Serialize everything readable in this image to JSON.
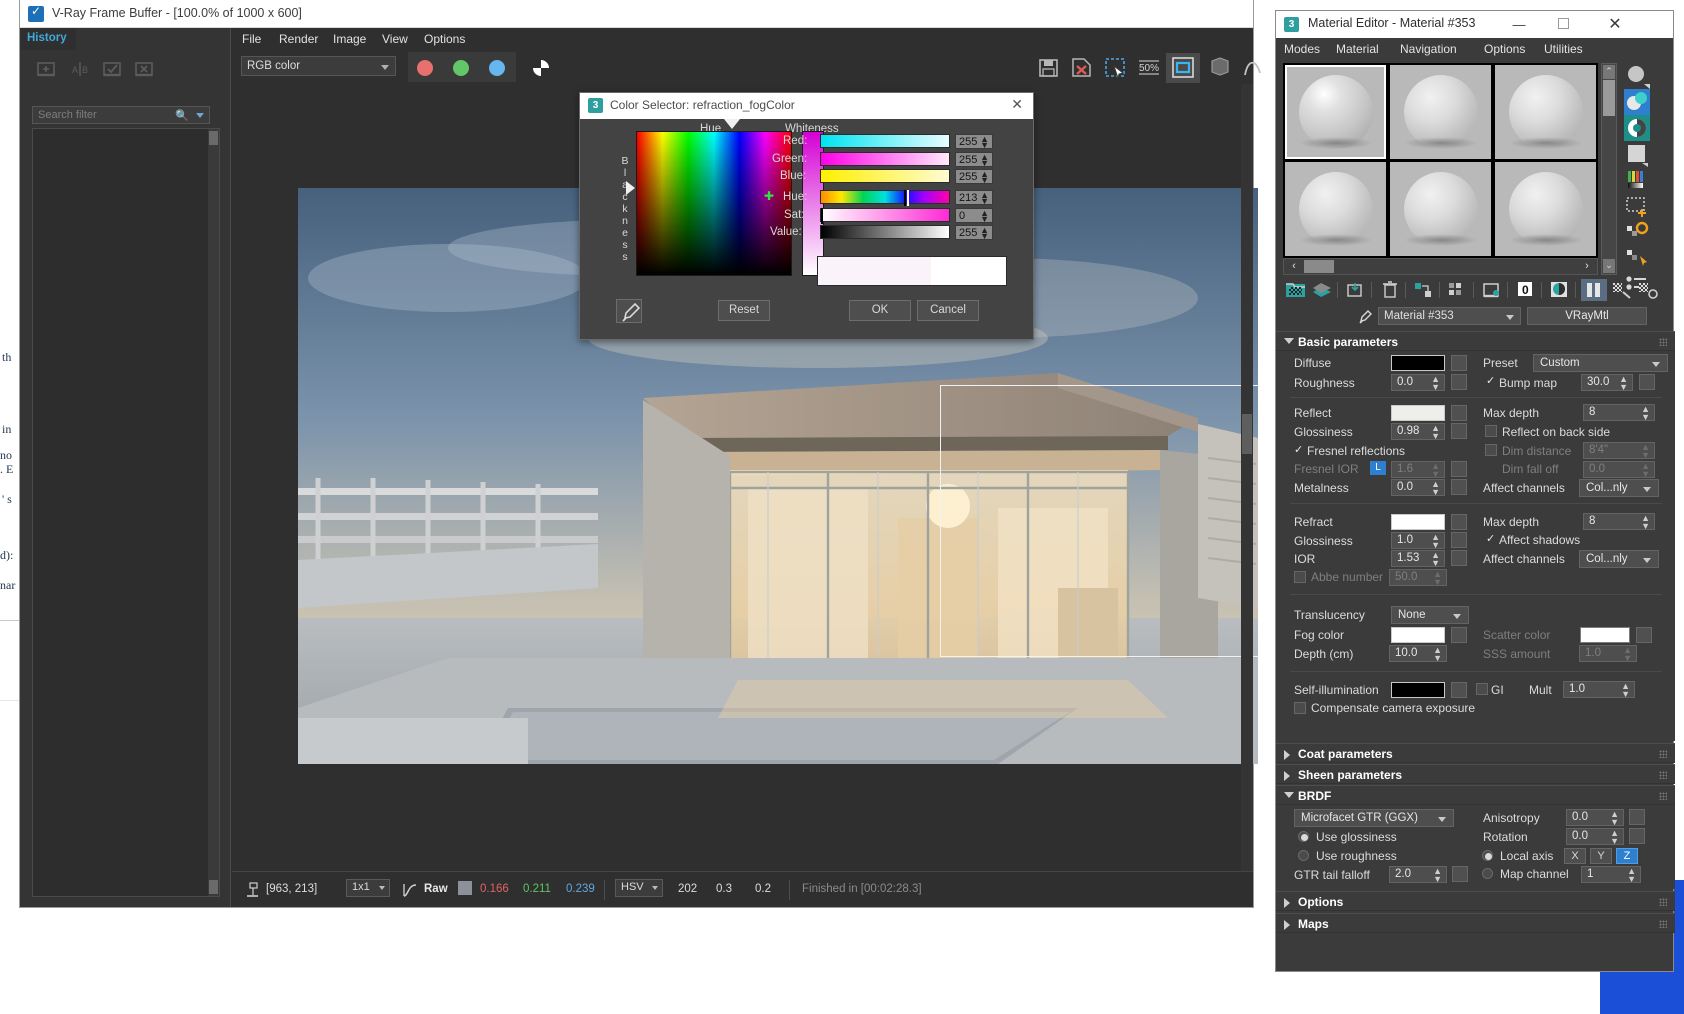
{
  "background_doc": {
    "fragments": [
      "th",
      "in",
      "no",
      ". E",
      "' s",
      "d):",
      "nar"
    ]
  },
  "vfb": {
    "title": "V-Ray Frame Buffer - [100.0% of 1000 x 600]",
    "title_icon": "vray-logo-icon",
    "history": {
      "tab_label": "History",
      "tools": [
        "history-save-icon",
        "history-compare-ab-icon",
        "history-set-icon",
        "history-delete-icon"
      ],
      "search_placeholder": "Search filter",
      "search_icon": "search-icon",
      "search_dropdown_icon": "chevron-down-icon"
    },
    "menu": [
      "File",
      "Render",
      "Image",
      "View",
      "Options"
    ],
    "toolbar": {
      "channel_combo": "RGB color",
      "channel_buttons": [
        "red-channel-icon",
        "green-channel-icon",
        "blue-channel-icon",
        "alpha-channel-icon"
      ],
      "right_icons": [
        "save-image-icon",
        "save-image-x-icon",
        "region-render-icon",
        "zoom-50-percent-icon",
        "fit-to-window-icon",
        "cube-icon",
        "curve-icon"
      ],
      "zoom_label": "50%"
    },
    "status": {
      "pixel_icon": "pixel-probe-icon",
      "coords": "[963, 213]",
      "sample_size": "1x1",
      "curve_icon": "color-curve-icon",
      "mode": "Raw",
      "swatch_color": "#8d9199",
      "r": "0.166",
      "g": "0.211",
      "b": "0.239",
      "colorspace": "HSV",
      "h": "202",
      "s": "0.3",
      "v": "0.2",
      "finished": "Finished in [00:02:28.3]"
    }
  },
  "color_selector": {
    "title": "Color Selector: refraction_fogColor",
    "title_icon": "max-logo-icon",
    "close_icon": "close-icon",
    "labels": {
      "hue": "Hue",
      "whiteness": "Whiteness",
      "blackness": "Blackness"
    },
    "channels": [
      {
        "name": "Red:",
        "value": "255"
      },
      {
        "name": "Green:",
        "value": "255"
      },
      {
        "name": "Blue:",
        "value": "255"
      }
    ],
    "hsv": [
      {
        "name": "Hue:",
        "value": "213"
      },
      {
        "name": "Sat:",
        "value": "0"
      },
      {
        "name": "Value:",
        "value": "255"
      }
    ],
    "eyedropper_icon": "eyedropper-icon",
    "buttons": {
      "reset": "Reset",
      "ok": "OK",
      "cancel": "Cancel"
    }
  },
  "material_editor": {
    "title": "Material Editor - Material #353",
    "title_icon": "max-logo-icon",
    "window_buttons": {
      "minimize": "—",
      "maximize": "❐",
      "close": "✕"
    },
    "menu": [
      "Modes",
      "Material",
      "Navigation",
      "Options",
      "Utilities"
    ],
    "slot_nav": {
      "prev": "‹",
      "next": "›"
    },
    "scroll_up": "⌃",
    "scroll_down": "⌄",
    "side_icons": [
      "sample-type-sphere-icon",
      "backlight-icon",
      "checker-background-icon",
      "sample-uv-tiling-icon",
      "video-color-check-icon",
      "make-preview-icon",
      "options-icon",
      "select-by-material-icon",
      "material-id-channel-icon"
    ],
    "toolbar_icons": [
      "get-material-icon",
      "assign-to-selection-icon",
      "show-shaded-icon",
      "delete-material-icon",
      "put-to-library-icon",
      "material-effects-id-icon",
      "show-in-viewport-icon",
      "show-end-result-icon",
      "go-to-parent-icon",
      "go-forward-sibling-icon",
      "pick-material-icon"
    ],
    "material_name": "Material #353",
    "material_type": "VRayMtl",
    "eyedropper_icon": "eyedropper-icon",
    "rollouts": {
      "basic": {
        "title": "Basic parameters",
        "open": true,
        "diffuse_label": "Diffuse",
        "diffuse_color": "#000000",
        "roughness_label": "Roughness",
        "roughness_value": "0.0",
        "preset_label": "Preset",
        "preset_value": "Custom",
        "bump_map_label": "Bump map",
        "bump_map_checked": true,
        "bump_map_value": "30.0",
        "reflect_label": "Reflect",
        "reflect_color": "#eeeeea",
        "max_depth_label": "Max depth",
        "max_depth_value": "8",
        "glossiness_label": "Glossiness",
        "glossiness_value": "0.98",
        "reflect_back_label": "Reflect on back side",
        "fresnel_label": "Fresnel reflections",
        "dim_distance_label": "Dim distance",
        "dim_distance_value": "8'4\"",
        "fresnel_ior_label": "Fresnel IOR",
        "fresnel_ior_lock": "L",
        "fresnel_ior_value": "1.6",
        "dim_falloff_label": "Dim fall off",
        "dim_falloff_value": "0.0",
        "metalness_label": "Metalness",
        "metalness_value": "0.0",
        "affect_channels_label": "Affect channels",
        "affect_channels_value": "Col...nly",
        "refract_label": "Refract",
        "refract_color": "#ffffff",
        "refract_max_depth_label": "Max depth",
        "refract_max_depth_value": "8",
        "refract_gloss_label": "Glossiness",
        "refract_gloss_value": "1.0",
        "affect_shadows_label": "Affect shadows",
        "ior_label": "IOR",
        "ior_value": "1.53",
        "refract_affect_channels_label": "Affect channels",
        "refract_affect_channels_value": "Col...nly",
        "abbe_label": "Abbe number",
        "abbe_value": "50.0",
        "translucency_label": "Translucency",
        "translucency_value": "None",
        "fog_color_label": "Fog color",
        "fog_color": "#ffffff",
        "scatter_color_label": "Scatter color",
        "scatter_color": "#ffffff",
        "depth_label": "Depth (cm)",
        "depth_value": "10.0",
        "sss_label": "SSS amount",
        "sss_value": "1.0",
        "self_illum_label": "Self-illumination",
        "self_illum_color": "#000000",
        "gi_label": "GI",
        "mult_label": "Mult",
        "mult_value": "1.0",
        "compensate_label": "Compensate camera exposure"
      },
      "coat": {
        "title": "Coat parameters",
        "open": false
      },
      "sheen": {
        "title": "Sheen parameters",
        "open": false
      },
      "brdf": {
        "title": "BRDF",
        "open": true,
        "model": "Microfacet GTR (GGX)",
        "use_glossiness_label": "Use glossiness",
        "use_roughness_label": "Use roughness",
        "gtr_tail_label": "GTR tail falloff",
        "gtr_tail_value": "2.0",
        "anisotropy_label": "Anisotropy",
        "anisotropy_value": "0.0",
        "rotation_label": "Rotation",
        "rotation_value": "0.0",
        "local_axis_label": "Local axis",
        "axis_x": "X",
        "axis_y": "Y",
        "axis_z": "Z",
        "map_channel_label": "Map channel",
        "map_channel_value": "1"
      },
      "options": {
        "title": "Options",
        "open": false
      },
      "maps": {
        "title": "Maps",
        "open": false
      }
    }
  },
  "colors": {
    "accent_blue": "#2f7fd0",
    "vfb_title_link": "#3fa9dd",
    "panel_bg": "#3b3b3b",
    "dark_bg": "#2f2f2f"
  }
}
